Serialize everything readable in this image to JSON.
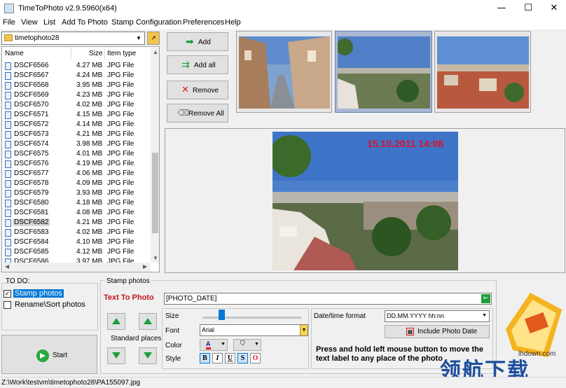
{
  "window": {
    "title": "TimeToPhoto v2.9.5960(x64)",
    "minimize": "—",
    "maximize": "☐",
    "close": "✕"
  },
  "menu": [
    "File",
    "View",
    "List",
    "Add To Photo",
    "Stamp Configuration",
    "Preferences",
    "Help"
  ],
  "folder": {
    "name": "timetophoto28"
  },
  "file_list": {
    "columns": [
      "Name",
      "Size",
      "Item type"
    ],
    "rows": [
      {
        "name": "DSCF6566",
        "size": "4.27 MB",
        "type": "JPG File"
      },
      {
        "name": "DSCF6567",
        "size": "4.24 MB",
        "type": "JPG File"
      },
      {
        "name": "DSCF6568",
        "size": "3.95 MB",
        "type": "JPG File"
      },
      {
        "name": "DSCF6569",
        "size": "4.23 MB",
        "type": "JPG File"
      },
      {
        "name": "DSCF6570",
        "size": "4.02 MB",
        "type": "JPG File"
      },
      {
        "name": "DSCF6571",
        "size": "4.15 MB",
        "type": "JPG File"
      },
      {
        "name": "DSCF6572",
        "size": "4.14 MB",
        "type": "JPG File"
      },
      {
        "name": "DSCF6573",
        "size": "4.21 MB",
        "type": "JPG File"
      },
      {
        "name": "DSCF6574",
        "size": "3.98 MB",
        "type": "JPG File"
      },
      {
        "name": "DSCF6575",
        "size": "4.01 MB",
        "type": "JPG File"
      },
      {
        "name": "DSCF6576",
        "size": "4.19 MB",
        "type": "JPG File"
      },
      {
        "name": "DSCF6577",
        "size": "4.06 MB",
        "type": "JPG File"
      },
      {
        "name": "DSCF6578",
        "size": "4.09 MB",
        "type": "JPG File"
      },
      {
        "name": "DSCF6579",
        "size": "3.93 MB",
        "type": "JPG File"
      },
      {
        "name": "DSCF6580",
        "size": "4.18 MB",
        "type": "JPG File"
      },
      {
        "name": "DSCF6581",
        "size": "4.08 MB",
        "type": "JPG File"
      },
      {
        "name": "DSCF6582",
        "size": "4.21 MB",
        "type": "JPG File",
        "selected": true
      },
      {
        "name": "DSCF6583",
        "size": "4.02 MB",
        "type": "JPG File"
      },
      {
        "name": "DSCF6584",
        "size": "4.10 MB",
        "type": "JPG File"
      },
      {
        "name": "DSCF6585",
        "size": "4.12 MB",
        "type": "JPG File"
      },
      {
        "name": "DSCF6586",
        "size": "3.97 MB",
        "type": "JPG File"
      }
    ]
  },
  "buttons": {
    "add": "Add",
    "add_all": "Add all",
    "remove": "Remove",
    "remove_all": "Remove All",
    "start": "Start",
    "include_photo_date": "Include Photo Date"
  },
  "preview": {
    "stamp_text": "15.10.2011 14:08",
    "stamp_color": "#e0102a"
  },
  "todo": {
    "title": "TO DO:",
    "items": [
      {
        "label": "Stamp photos",
        "checked": true
      },
      {
        "label": "Rename\\Sort photos",
        "checked": false
      }
    ]
  },
  "stamp": {
    "group_title": "Stamp photos",
    "text_to_photo_label": "Text To Photo",
    "text_value": "[PHOTO_DATE]",
    "standard_places": "Standard places",
    "size_label": "Size",
    "font_label": "Font",
    "font_value": "Arial",
    "color_label": "Color",
    "style_label": "Style",
    "style_buttons": [
      "B",
      "I",
      "U",
      "S",
      "O"
    ],
    "datetime_label": "Date/time format",
    "datetime_value": "DD.MM.YYYY hh:nn",
    "hint": "Press and hold left mouse button to move the text label to any place of the photo"
  },
  "watermark": {
    "site": "lhdown.com",
    "cn": "领航下载"
  },
  "status": {
    "path": "Z:\\Work\\testvm\\timetophoto28\\PA155097.jpg"
  }
}
